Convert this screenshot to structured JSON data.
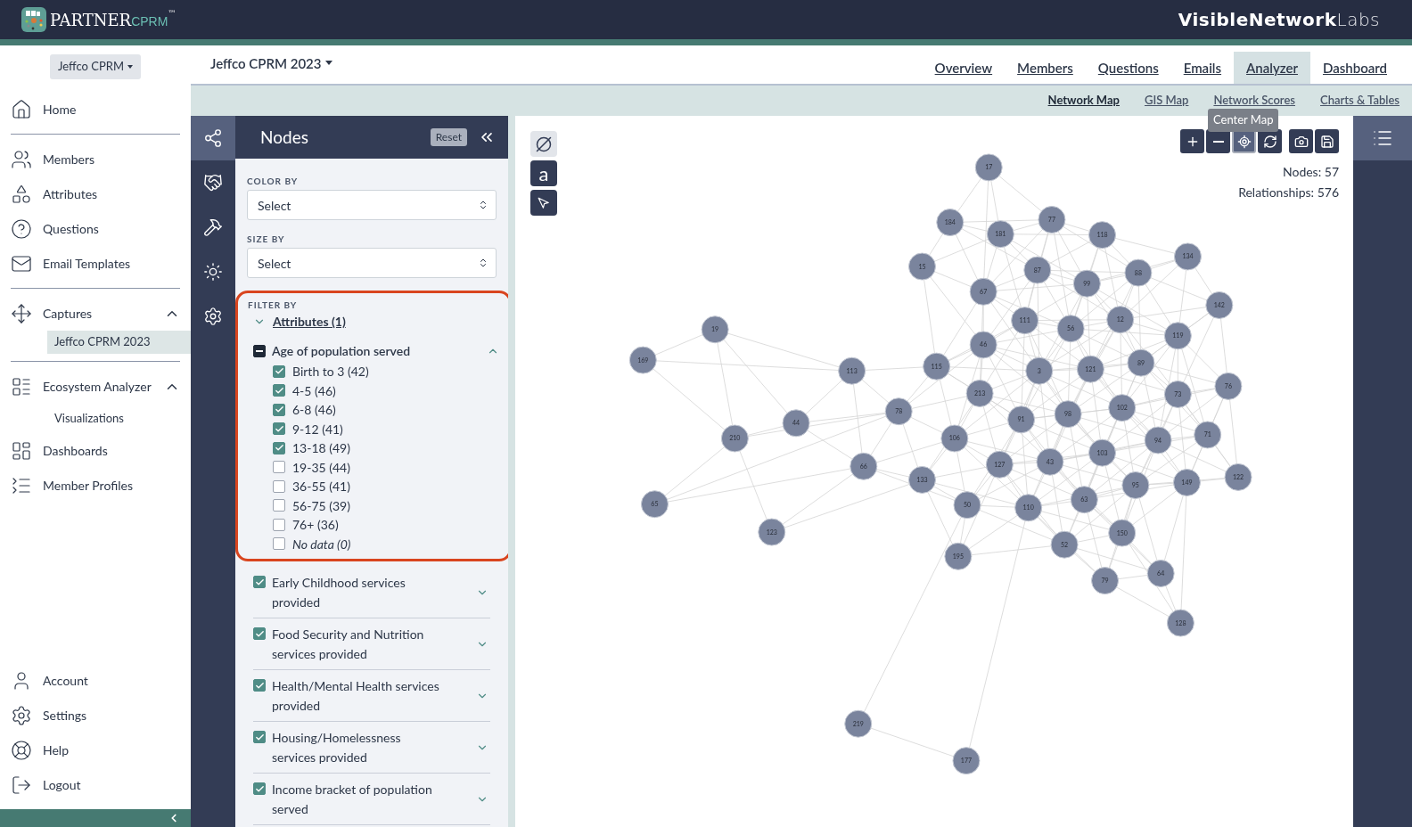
{
  "header": {
    "brand": "PARTNER",
    "brand_accent": "CPRM",
    "brand_mark": "™",
    "partner_logo": [
      {
        "text": "VisibleNetwork",
        "kind": "strong"
      },
      {
        "text": "Labs",
        "kind": "light"
      }
    ]
  },
  "sidebar": {
    "org": "Jeffco CPRM",
    "sections": [
      {
        "items": [
          {
            "label": "Home"
          }
        ]
      },
      {
        "items": [
          {
            "label": "Members"
          },
          {
            "label": "Attributes"
          },
          {
            "label": "Questions"
          },
          {
            "label": "Email Templates"
          }
        ]
      },
      {
        "items": [
          {
            "label": "Captures",
            "expanded": true,
            "children": [
              {
                "label": "Jeffco CPRM 2023",
                "selected": true
              }
            ]
          }
        ]
      },
      {
        "items": [
          {
            "label": "Ecosystem Analyzer",
            "expanded": true,
            "children": [
              {
                "label": "Visualizations",
                "selected": false
              }
            ]
          },
          {
            "label": "Dashboards"
          },
          {
            "label": "Member Profiles"
          }
        ]
      }
    ],
    "bottom": [
      {
        "label": "Account"
      },
      {
        "label": "Settings"
      },
      {
        "label": "Help"
      },
      {
        "label": "Logout"
      }
    ]
  },
  "topnav": {
    "project": "Jeffco CPRM 2023",
    "tabs": [
      {
        "label": "Overview",
        "selected": false
      },
      {
        "label": "Members",
        "selected": false
      },
      {
        "label": "Questions",
        "selected": false
      },
      {
        "label": "Emails",
        "selected": false
      },
      {
        "label": "Analyzer",
        "selected": true
      },
      {
        "label": "Dashboard",
        "selected": false
      }
    ]
  },
  "subnav": {
    "tabs": [
      {
        "label": "Network Map",
        "selected": true
      },
      {
        "label": "GIS Map",
        "selected": false
      },
      {
        "label": "Network Scores",
        "selected": false
      },
      {
        "label": "Charts & Tables",
        "selected": false
      }
    ]
  },
  "rail": [
    {
      "selected": true
    },
    {
      "selected": false
    },
    {
      "selected": false
    },
    {
      "selected": false
    },
    {
      "selected": false
    }
  ],
  "panel": {
    "title": "Nodes",
    "reset": "Reset",
    "color_by": {
      "label": "COLOR BY",
      "value": "Select"
    },
    "size_by": {
      "label": "SIZE BY",
      "value": "Select"
    },
    "filter": {
      "label": "FILTER BY",
      "group": "Attributes (1)",
      "expanded": true,
      "attribute": {
        "label": "Age of population served",
        "partial": true,
        "expanded": true,
        "options": [
          {
            "label": "Birth to 3 (42)",
            "checked": true,
            "kind": "value"
          },
          {
            "label": "4-5 (46)",
            "checked": true,
            "kind": "value"
          },
          {
            "label": "6-8 (46)",
            "checked": true,
            "kind": "value"
          },
          {
            "label": "9-12 (41)",
            "checked": true,
            "kind": "value"
          },
          {
            "label": "13-18 (49)",
            "checked": true,
            "kind": "value"
          },
          {
            "label": "19-35 (44)",
            "checked": false,
            "kind": "value"
          },
          {
            "label": "36-55 (41)",
            "checked": false,
            "kind": "value"
          },
          {
            "label": "56-75 (39)",
            "checked": false,
            "kind": "value"
          },
          {
            "label": "76+ (36)",
            "checked": false,
            "kind": "value"
          },
          {
            "label": "No data (0)",
            "checked": false,
            "kind": "no_data"
          }
        ]
      }
    },
    "attributes": [
      {
        "label": "Early Childhood services provided",
        "checked": true,
        "expanded": false
      },
      {
        "label": "Food Security and Nutrition services provided",
        "checked": true,
        "expanded": false
      },
      {
        "label": "Health/Mental Health services provided",
        "checked": true,
        "expanded": false
      },
      {
        "label": "Housing/Homelessness services provided",
        "checked": true,
        "expanded": false
      },
      {
        "label": "Income bracket of population served",
        "checked": true,
        "expanded": false
      }
    ]
  },
  "map": {
    "tools": [
      {
        "kind": "clear",
        "selected": true
      },
      {
        "kind": "label",
        "text": "a",
        "selected": false
      },
      {
        "kind": "select",
        "selected": false
      }
    ],
    "controls": [
      {
        "kind": "zoom_in",
        "selected": false
      },
      {
        "kind": "zoom_out",
        "selected": false
      },
      {
        "kind": "center",
        "selected": true
      },
      {
        "kind": "refresh",
        "selected": false
      },
      {
        "kind": "snapshot",
        "selected": false
      },
      {
        "kind": "save",
        "selected": false
      }
    ],
    "tooltip": "Center Map",
    "node_count": "Nodes: 57",
    "relationship_count": "Relationships: 576",
    "nodes": [
      "17",
      "184",
      "181",
      "77",
      "118",
      "134",
      "15",
      "87",
      "99",
      "88",
      "142",
      "67",
      "111",
      "56",
      "12",
      "119",
      "19",
      "169",
      "46",
      "113",
      "115",
      "3",
      "121",
      "89",
      "76",
      "213",
      "73",
      "102",
      "78",
      "44",
      "91",
      "98",
      "210",
      "94",
      "71",
      "106",
      "103",
      "127",
      "43",
      "66",
      "149",
      "122",
      "95",
      "133",
      "63",
      "50",
      "110",
      "65",
      "150",
      "123",
      "52",
      "195",
      "79",
      "64",
      "128",
      "219",
      "177"
    ]
  }
}
